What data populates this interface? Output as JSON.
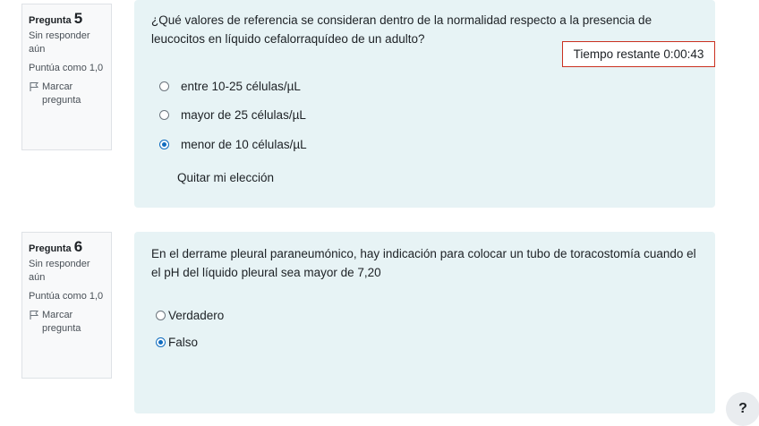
{
  "questions": [
    {
      "label": "Pregunta",
      "number": "5",
      "state": "Sin responder aún",
      "grade": "Puntúa como 1,0",
      "flag_label": "Marcar pregunta",
      "text": "¿Qué valores de referencia se consideran dentro de la normalidad respecto a la presencia de leucocitos en líquido cefalorraquídeo de un adulto?",
      "options": [
        {
          "label": "entre 10-25 células/µL",
          "selected": false
        },
        {
          "label": "mayor de 25 células/µL",
          "selected": false
        },
        {
          "label": "menor de 10 células/µL",
          "selected": true
        }
      ],
      "clear_choice": "Quitar mi elección"
    },
    {
      "label": "Pregunta",
      "number": "6",
      "state": "Sin responder aún",
      "grade": "Puntúa como 1,0",
      "flag_label": "Marcar pregunta",
      "text": "En el derrame pleural paraneumónico, hay indicación para colocar un tubo de toracostomía cuando el el pH del líquido pleural sea mayor de 7,20",
      "options": [
        {
          "label": "Verdadero",
          "selected": false
        },
        {
          "label": "Falso",
          "selected": true
        }
      ]
    }
  ],
  "timer": {
    "text": "Tiempo restante 0:00:43"
  },
  "help_button": {
    "label": "?"
  },
  "colors": {
    "accent": "#0f6cbf",
    "timer_border": "#ca3120",
    "question_bg": "#e7f3f5"
  }
}
